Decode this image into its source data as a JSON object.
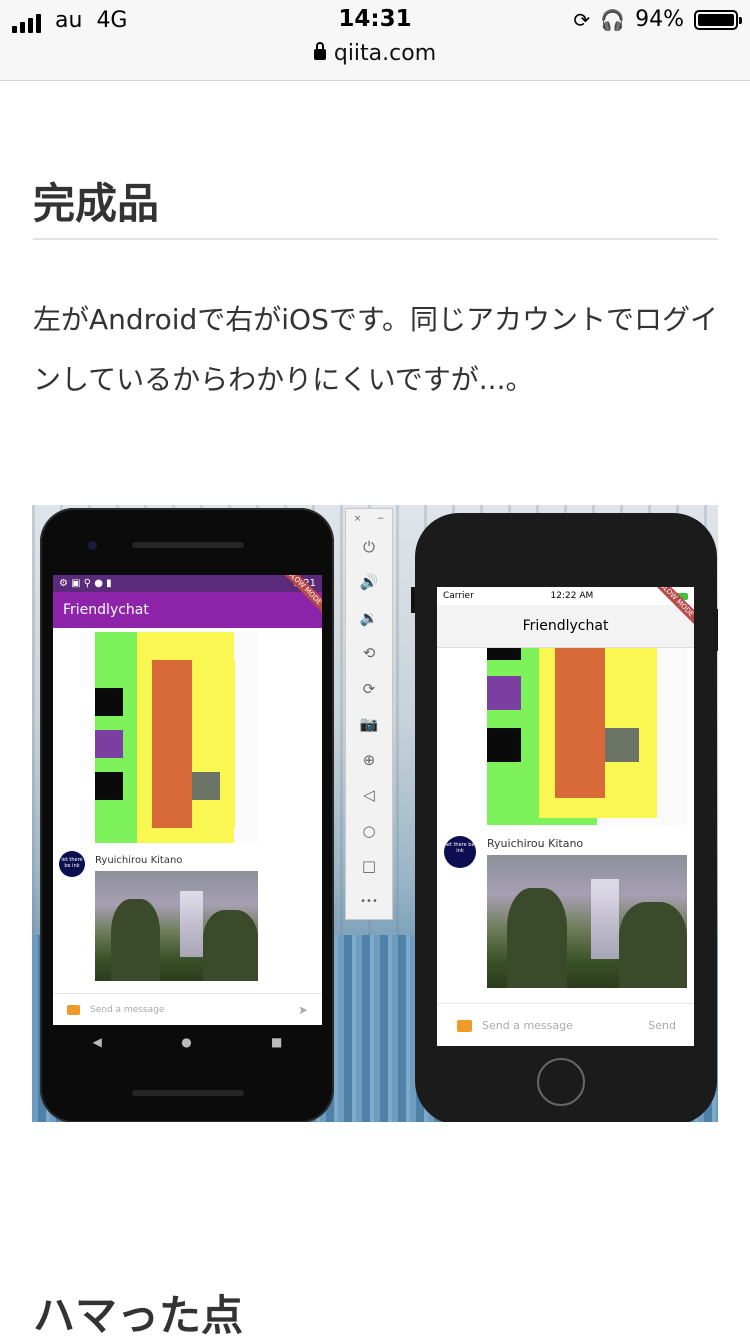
{
  "statusbar": {
    "carrier": "au",
    "network": "4G",
    "time": "14:31",
    "battery_percent": "94%",
    "battery_level": 0.94,
    "url": "qiita.com",
    "icons": [
      "signal-bars-icon",
      "lock-rotation-icon",
      "headphones-icon",
      "battery-icon",
      "lock-icon"
    ]
  },
  "article": {
    "heading_done": "完成品",
    "paragraph": "左がAndroidで右がiOSです。同じアカウントでログインしているからわかりにくいですが...。",
    "heading_issues": "ハマった点"
  },
  "figure": {
    "android": {
      "status_time": "3:21",
      "app_title": "Friendlychat",
      "slow_mode": "SLOW MODE",
      "sender": "Ryuichirou Kitano",
      "avatar_text": "let there be ink",
      "composer_placeholder": "Send a message",
      "nav": [
        "◀",
        "●",
        "■"
      ]
    },
    "toolbar": {
      "close": "×",
      "minimize": "−",
      "icons": [
        "power-icon",
        "volume-up-icon",
        "volume-down-icon",
        "rotate-left-icon",
        "rotate-right-icon",
        "camera-icon",
        "zoom-icon",
        "back-icon",
        "home-icon",
        "overview-icon",
        "more-icon"
      ],
      "glyphs": [
        "⏻",
        "🔊",
        "🔉",
        "⟲",
        "⟳",
        "📷",
        "⊕",
        "◁",
        "○",
        "□",
        "•••"
      ]
    },
    "iphone": {
      "carrier": "Carrier",
      "status_time": "12:22 AM",
      "app_title": "Friendlychat",
      "slow_mode": "SLOW MODE",
      "sender": "Ryuichirou Kitano",
      "avatar_text": "let there be ink",
      "composer_placeholder": "Send a message",
      "send_label": "Send"
    },
    "colors": {
      "android_appbar": "#8e24aa",
      "green": "#7ef25a",
      "yellow": "#fbf752",
      "orange": "#d86a3a",
      "purple": "#7a3fa0",
      "black": "#0a0a0a",
      "gray": "#6b7466"
    }
  }
}
